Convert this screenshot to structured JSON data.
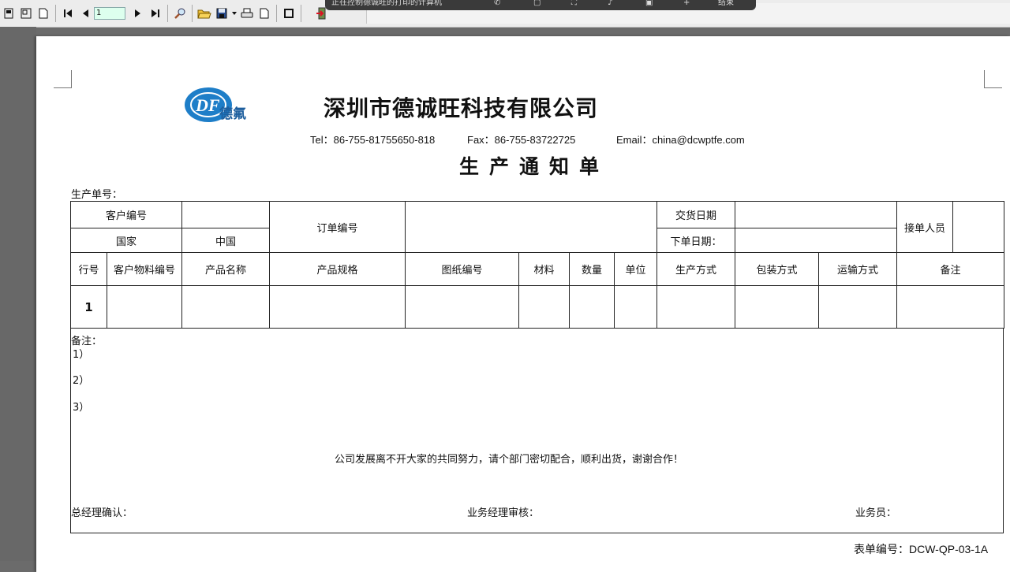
{
  "toolbar": {
    "page_number": "1",
    "icons": [
      "page-setup-icon",
      "page-icon",
      "blank-page-icon",
      "first-page-icon",
      "prev-page-icon",
      "next-page-icon",
      "last-page-icon",
      "zoom-icon",
      "open-folder-icon",
      "save-icon",
      "dropdown-arrow-icon",
      "print-icon",
      "export-page-icon",
      "stop-icon",
      "exit-door-icon"
    ]
  },
  "recording_bar": {
    "title": "正在控制德诚旺的打印的计算机",
    "end_label": "结束"
  },
  "header": {
    "company": "深圳市德诚旺科技有限公司",
    "logo_text": "德氟",
    "tel": "Tel：86-755-81755650-818",
    "fax": "Fax：86-755-83722725",
    "email": "Email：china@dcwptfe.com",
    "title": "生产通知单",
    "order_no_label": "生产单号："
  },
  "table": {
    "customer_no": "客户编号",
    "country": "国家",
    "country_value": "中国",
    "order_no": "订单编号",
    "delivery_date": "交货日期",
    "order_date": "下单日期：",
    "receiver": "接单人员",
    "columns": [
      "行号",
      "客户物料编号",
      "产品名称",
      "产品规格",
      "图纸编号",
      "材料",
      "数量",
      "单位",
      "生产方式",
      "包装方式",
      "运输方式",
      "备注"
    ],
    "rows": [
      [
        "1",
        "",
        "",
        "",
        "",
        "",
        "",
        "",
        "",
        "",
        "",
        ""
      ]
    ]
  },
  "notes": {
    "label": "备注：",
    "items": [
      "1）",
      "2）",
      "3）"
    ],
    "slogan": "公司发展离不开大家的共同努力，请个部门密切配合，顺利出货，谢谢合作！",
    "gm_confirm": "总经理确认：",
    "manager_review": "业务经理审核：",
    "salesperson": "业务员："
  },
  "footer": {
    "form_no": "表单编号：DCW-QP-03-1A"
  },
  "colors": {
    "logo_blue": "#1e7ec8",
    "toolbar_bg": "#ececec",
    "page_bg": "#ffffff"
  }
}
